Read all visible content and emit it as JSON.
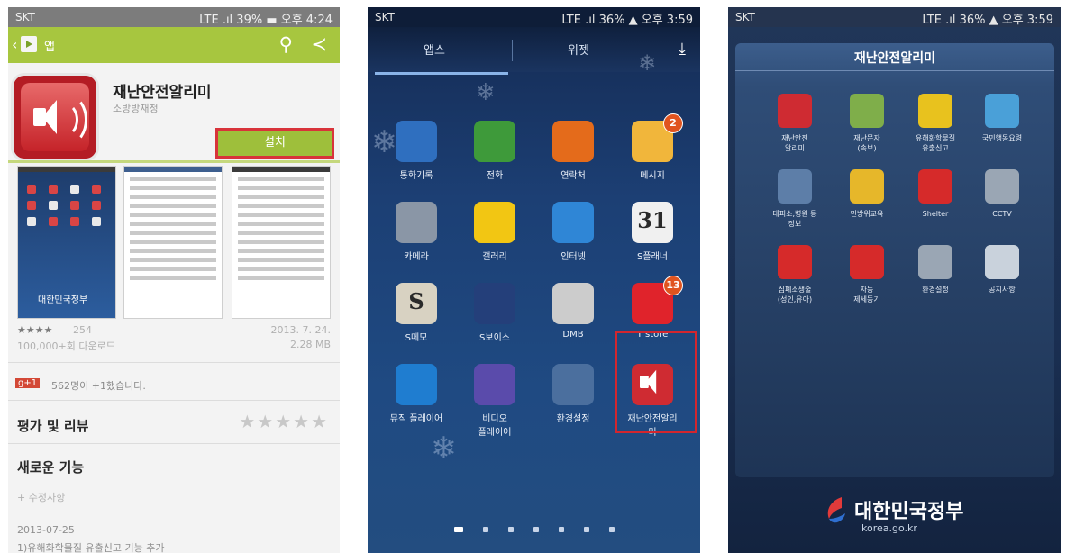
{
  "phone1": {
    "status": {
      "carrier": "SKT",
      "right": "LTE .ıl 39% ▬ 오후 4:24"
    },
    "action_bar": {
      "title": "앱"
    },
    "app": {
      "title": "재난안전알리미",
      "developer": "소방방재청",
      "install_label": "설치"
    },
    "rating_count": "254",
    "date": "2013. 7. 24.",
    "downloads": "100,000+회 다운로드",
    "size": "2.28 MB",
    "plusone_text": "562명이 +1했습니다.",
    "reviews_heading": "평가 및 리뷰",
    "whats_new_heading": "새로운 기능",
    "whats_new_sub": "+ 수정사항",
    "changelog_date": "2013-07-25",
    "changelog_item": "1)유해화학물질 유출신고 기능 추가",
    "screenshot_logo": "대한민국정부"
  },
  "phone2": {
    "status": {
      "carrier": "SKT",
      "right": "LTE .ıl 36% ▲ 오후 3:59"
    },
    "tabs": [
      "앱스",
      "위젯"
    ],
    "apps": [
      {
        "label": "통화기록",
        "icon": "call-log-icon",
        "color": "#2f6fbf"
      },
      {
        "label": "전화",
        "icon": "phone-icon",
        "color": "#3e9a3a"
      },
      {
        "label": "연락처",
        "icon": "contacts-icon",
        "color": "#e46b1b"
      },
      {
        "label": "메시지",
        "icon": "messages-icon",
        "color": "#f1b63b",
        "badge": "2"
      },
      {
        "label": "카메라",
        "icon": "camera-icon",
        "color": "#8a96a6"
      },
      {
        "label": "갤러리",
        "icon": "gallery-icon",
        "color": "#f2c613"
      },
      {
        "label": "인터넷",
        "icon": "internet-icon",
        "color": "#2f86d6"
      },
      {
        "label": "S플래너",
        "icon": "calendar-icon",
        "color": "#f0f0f0",
        "text": "31"
      },
      {
        "label": "S메모",
        "icon": "s-memo-icon",
        "color": "#d8d2c2",
        "text": "S"
      },
      {
        "label": "S보이스",
        "icon": "s-voice-icon",
        "color": "#243f7a"
      },
      {
        "label": "DMB",
        "icon": "dmb-icon",
        "color": "#cccccc"
      },
      {
        "label": "T store",
        "icon": "t-store-icon",
        "color": "#e0232b",
        "badge": "13"
      },
      {
        "label": "뮤직 플레이어",
        "icon": "music-player-icon",
        "color": "#1f7dd0"
      },
      {
        "label": "비디오\n플레이어",
        "icon": "video-player-icon",
        "color": "#5a4bab"
      },
      {
        "label": "환경설정",
        "icon": "settings-icon",
        "color": "#4b6f9e"
      },
      {
        "label": "재난안전알리\n미",
        "icon": "disaster-alert-icon",
        "color": "#cf2b32"
      }
    ]
  },
  "phone3": {
    "status": {
      "carrier": "SKT",
      "right": "LTE .ıl 36% ▲ 오후 3:59"
    },
    "folder_title": "재난안전알리미",
    "items": [
      {
        "label": "재난안전\n알리미",
        "icon": "speaker-alert-icon",
        "color": "#cf2b32"
      },
      {
        "label": "재난문자\n(속보)",
        "icon": "disaster-sms-icon",
        "color": "#7fae4a"
      },
      {
        "label": "유해화학물질\n유출신고",
        "icon": "chemical-report-icon",
        "color": "#e8c21e"
      },
      {
        "label": "국민행동요령",
        "icon": "action-guide-icon",
        "color": "#4aa0d8"
      },
      {
        "label": "대피소,병원 등\n정보",
        "icon": "shelter-search-icon",
        "color": "#5d7ea8"
      },
      {
        "label": "민방위교육",
        "icon": "civil-defense-icon",
        "color": "#e6b72a"
      },
      {
        "label": "Shelter",
        "icon": "shelter-icon",
        "color": "#d62a2a"
      },
      {
        "label": "CCTV",
        "icon": "cctv-icon",
        "color": "#9aa6b4"
      },
      {
        "label": "심폐소생술\n(성인,유아)",
        "icon": "cpr-icon",
        "color": "#d62a2a"
      },
      {
        "label": "자동\n제세동기",
        "icon": "defibrillator-icon",
        "color": "#d62a2a"
      },
      {
        "label": "환경설정",
        "icon": "settings-gear-icon",
        "color": "#9aa6b4"
      },
      {
        "label": "공지사항",
        "icon": "notice-icon",
        "color": "#c9d2dc"
      }
    ],
    "gov_name": "대한민국정부",
    "gov_url": "korea.go.kr"
  }
}
